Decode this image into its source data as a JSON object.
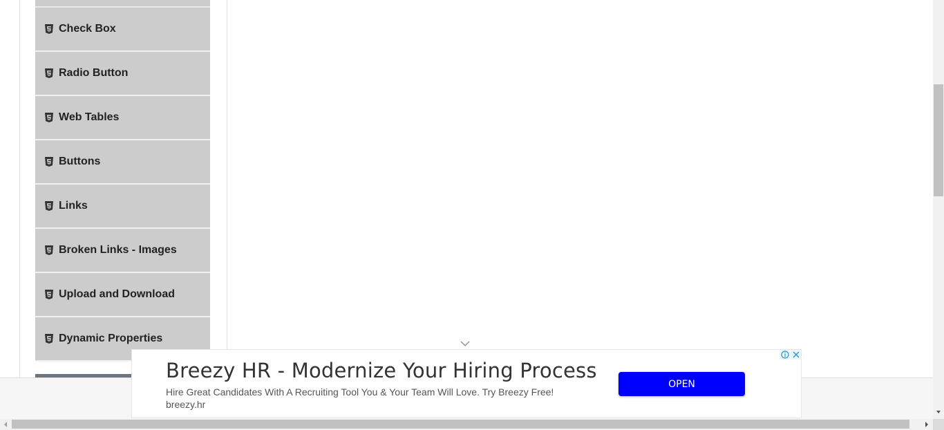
{
  "sidebar": {
    "items": [
      {
        "label": "Check Box",
        "icon": "html5-icon"
      },
      {
        "label": "Radio Button",
        "icon": "html5-icon"
      },
      {
        "label": "Web Tables",
        "icon": "html5-icon"
      },
      {
        "label": "Buttons",
        "icon": "html5-icon"
      },
      {
        "label": "Links",
        "icon": "html5-icon"
      },
      {
        "label": "Broken Links - Images",
        "icon": "html5-icon"
      },
      {
        "label": "Upload and Download",
        "icon": "html5-icon"
      },
      {
        "label": "Dynamic Properties",
        "icon": "html5-icon"
      }
    ]
  },
  "ad": {
    "title": "Breezy HR - Modernize Your Hiring Process",
    "description": "Hire Great Candidates With A Recruiting Tool You & Your Team Will Love. Try Breezy Free!",
    "domain": "breezy.hr",
    "cta_label": "OPEN",
    "cta_color": "#0000ff",
    "badges": [
      "info-icon",
      "close-icon"
    ]
  },
  "colors": {
    "sidebar_bg": "#cccccc",
    "sidebar_active_bar": "#6c757d"
  }
}
